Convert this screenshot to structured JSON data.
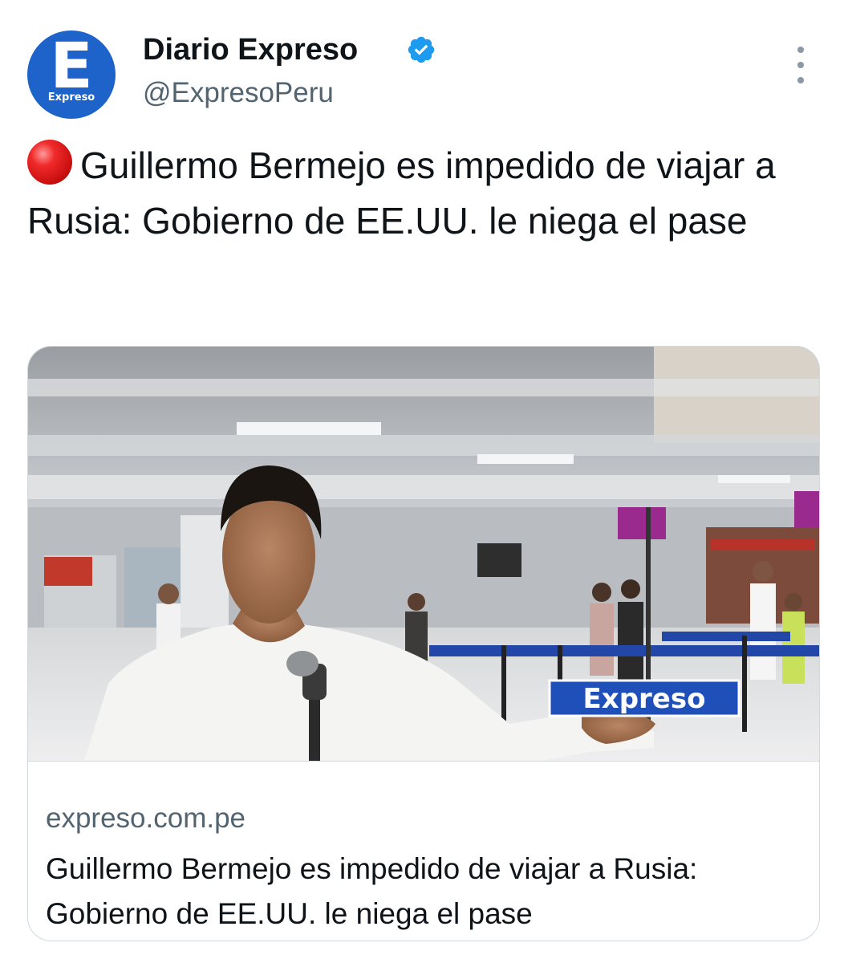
{
  "account": {
    "avatar_letter": "E",
    "avatar_word": "Expreso",
    "display_name": "Diario Expreso",
    "handle": "@ExpresoPeru",
    "verified_icon": "verified-badge-icon"
  },
  "menu_icon": "more-options-icon",
  "tweet": {
    "emoji_icon": "red-circle-icon",
    "text": "Guillermo Bermejo es impedido de viajar a Rusia: Gobierno de EE.UU. le niega el pase"
  },
  "card": {
    "image_watermark": "Expreso",
    "domain": "expreso.com.pe",
    "title": "Guillermo Bermejo es impedido de viajar a Rusia: Gobierno de EE.UU. le niega el pase"
  },
  "colors": {
    "brand_blue": "#1d63c9",
    "verified_blue": "#1d9bf0",
    "secondary_text": "#536471",
    "border": "#cfd9de"
  }
}
